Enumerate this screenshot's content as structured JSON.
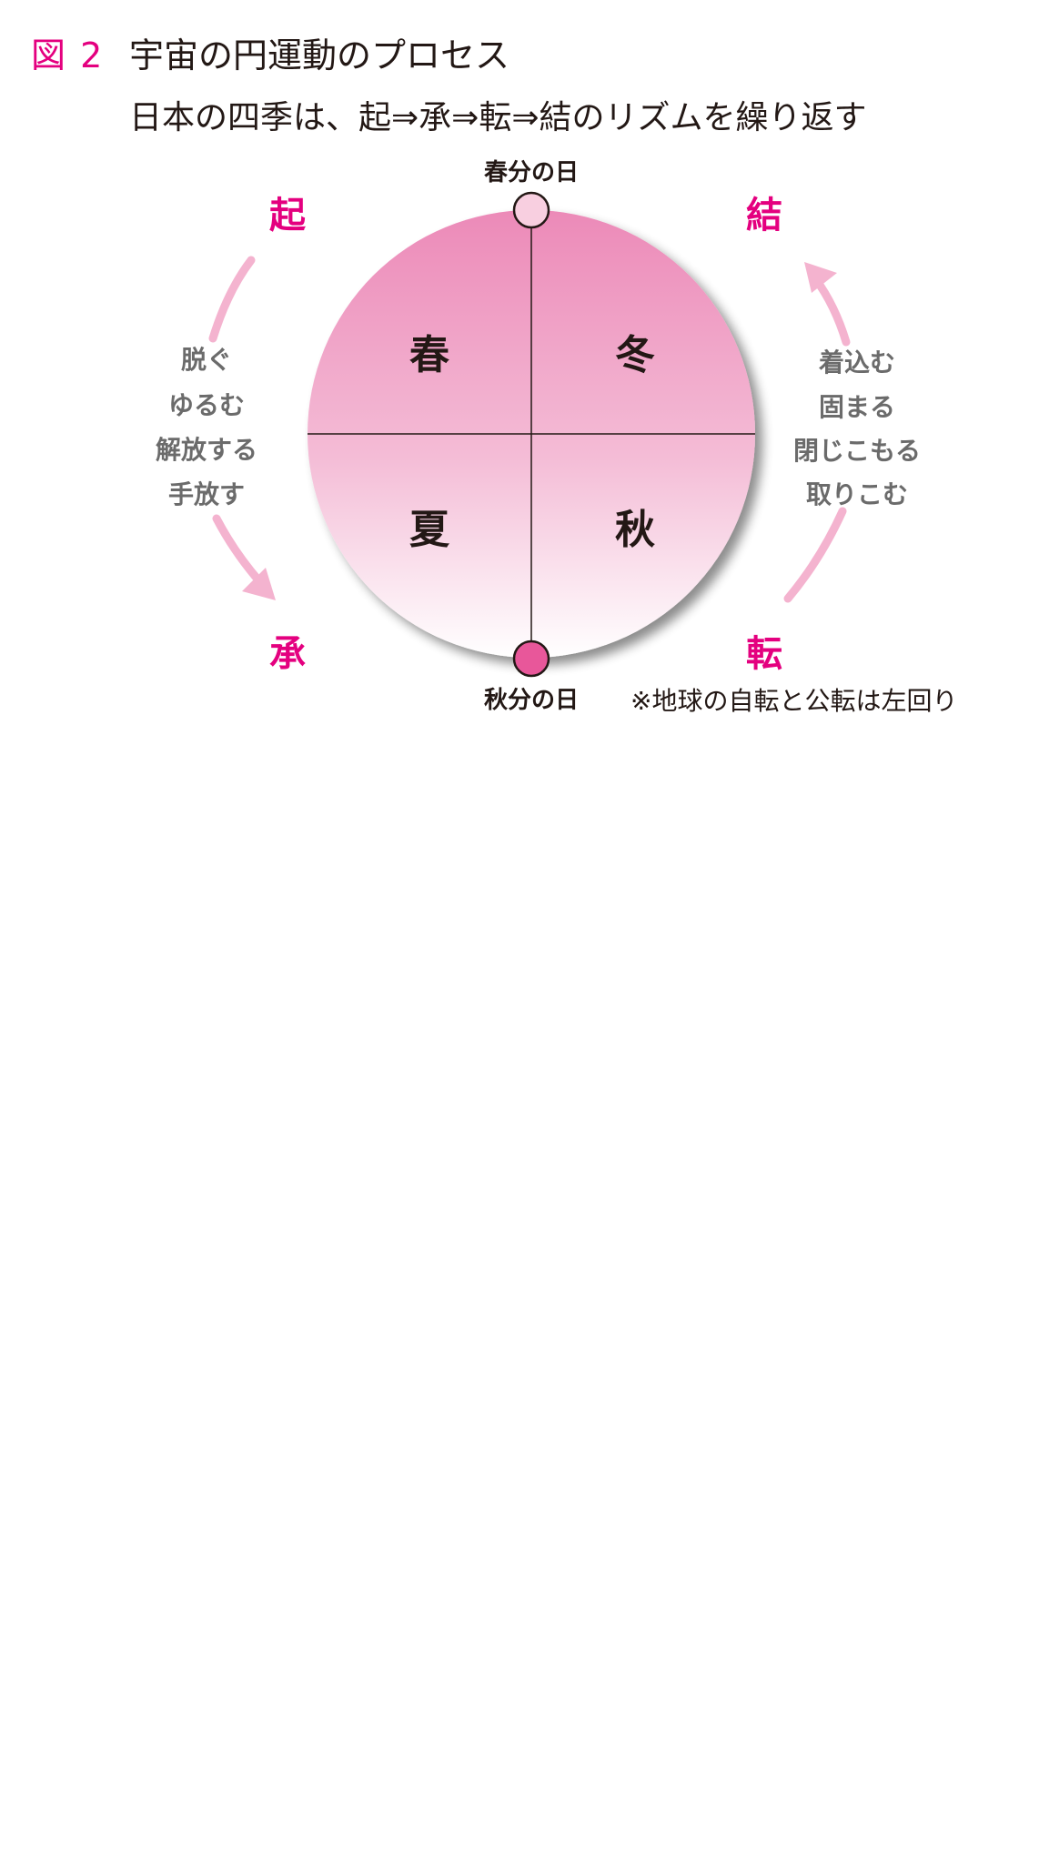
{
  "figure": {
    "label": "図 2",
    "title": "宇宙の円運動のプロセス",
    "subtitle": "日本の四季は、起⇒承⇒転⇒結のリズムを繰り返す"
  },
  "stages": {
    "ki": "起",
    "sho": "承",
    "ten": "転",
    "ketsu": "結"
  },
  "seasons": {
    "spring": "春",
    "winter": "冬",
    "summer": "夏",
    "autumn": "秋"
  },
  "markers": {
    "top": "春分の日",
    "bottom": "秋分の日"
  },
  "left_actions": [
    "脱ぐ",
    "ゆるむ",
    "解放する",
    "手放す"
  ],
  "right_actions": [
    "着込む",
    "固まる",
    "閉じこもる",
    "取りこむ"
  ],
  "note": "※地球の自転と公転は左回り",
  "colors": {
    "accent": "#e4007f",
    "circle_top": "#ec8ab8",
    "circle_bottom": "#ffffff",
    "arrow": "#f4b3cf",
    "marker_top_fill": "#f8cfe0",
    "marker_bottom_fill": "#e8579a"
  }
}
